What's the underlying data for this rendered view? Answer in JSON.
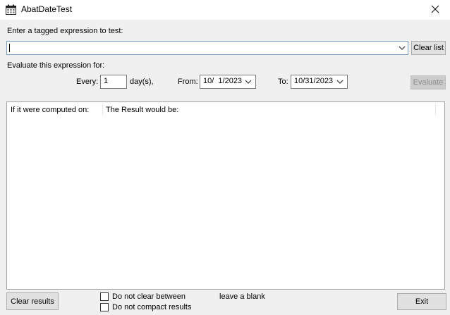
{
  "window": {
    "title": "AbatDateTest",
    "close_label": "✕"
  },
  "expression": {
    "prompt": "Enter a tagged expression to test:",
    "value": "",
    "clear_list_label": "Clear list"
  },
  "evaluate": {
    "section_label": "Evaluate this expression for:",
    "every_label": "Every:",
    "every_value": "1",
    "days_label": "day(s),",
    "from_label": "From:",
    "from_value": "10/  1/2023",
    "to_label": "To:",
    "to_value": "10/31/2023",
    "evaluate_button": "Evaluate"
  },
  "results": {
    "columns": [
      "If it were computed on:",
      "The Result would be:"
    ],
    "rows": []
  },
  "footer": {
    "clear_results_label": "Clear results",
    "do_not_clear_label": "Do not clear between",
    "leave_blank_label": "leave a blank",
    "do_not_compact_label": "Do not compact results",
    "exit_label": "Exit"
  }
}
